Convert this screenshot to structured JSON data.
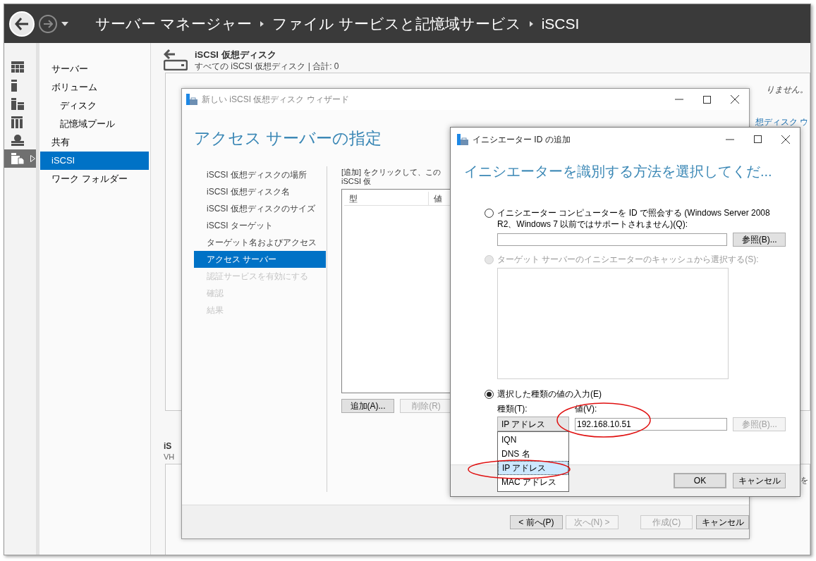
{
  "top_bar": {
    "back": {
      "disabled": false
    },
    "forward": {
      "disabled": true
    },
    "breadcrumb": [
      "サーバー マネージャー",
      "ファイル サービスと記憶域サービス",
      "iSCSI"
    ]
  },
  "rail": [
    {
      "kind": "dashboard",
      "selected": false
    },
    {
      "kind": "server",
      "selected": false
    },
    {
      "kind": "servers",
      "selected": false
    },
    {
      "kind": "group",
      "selected": false
    },
    {
      "kind": "network",
      "selected": false
    },
    {
      "kind": "storage",
      "selected": true
    }
  ],
  "nav": [
    {
      "label": "サーバー",
      "selected": false
    },
    {
      "label": "ボリューム",
      "selected": false,
      "children": [
        {
          "label": "ディスク",
          "selected": false
        },
        {
          "label": "記憶域プール",
          "selected": false
        }
      ]
    },
    {
      "label": "共有",
      "selected": false
    },
    {
      "label": "iSCSI",
      "selected": true
    },
    {
      "label": "ワーク フォルダー",
      "selected": false
    }
  ],
  "content": {
    "title": "iSCSI 仮想ディスク",
    "subtitle": "すべての iSCSI 仮想ディスク | 合計: 0",
    "panel_text_1": "りません。",
    "panel_link": "想ディスク ウ",
    "section_title": "iS",
    "section_subtitle": "VH",
    "section_text": "を"
  },
  "wizard": {
    "title": "新しい iSCSI 仮想ディスク ウィザード",
    "heading": "アクセス サーバーの指定",
    "steps": [
      {
        "label": "iSCSI 仮想ディスクの場所",
        "selected": false,
        "disabled": false
      },
      {
        "label": "iSCSI 仮想ディスク名",
        "selected": false,
        "disabled": false
      },
      {
        "label": "iSCSI 仮想ディスクのサイズ",
        "selected": false,
        "disabled": false
      },
      {
        "label": "iSCSI ターゲット",
        "selected": false,
        "disabled": false
      },
      {
        "label": "ターゲット名およびアクセス",
        "selected": false,
        "disabled": false
      },
      {
        "label": "アクセス サーバー",
        "selected": true,
        "disabled": false
      },
      {
        "label": "認証サービスを有効にする",
        "selected": false,
        "disabled": true
      },
      {
        "label": "確認",
        "selected": false,
        "disabled": true
      },
      {
        "label": "結果",
        "selected": false,
        "disabled": true
      }
    ],
    "instruction": "[追加] をクリックして、この iSCSI 仮",
    "table": {
      "columns": [
        "型",
        "値"
      ]
    },
    "buttons": [
      {
        "label": "追加(A)...",
        "disabled": false
      },
      {
        "label": "削除(R)",
        "disabled": true
      }
    ],
    "footer_buttons": [
      {
        "label": "< 前へ(P)",
        "disabled": false
      },
      {
        "label": "次へ(N) >",
        "disabled": true
      },
      {
        "label": "作成(C)",
        "disabled": true
      },
      {
        "label": "キャンセル",
        "disabled": false
      }
    ]
  },
  "dialog": {
    "title": "イニシエーター ID の追加",
    "heading": "イニシエーターを識別する方法を選択してくだ...",
    "options": [
      {
        "label": "イニシエーター コンピューターを ID で照会する (Windows Server 2008 R2、Windows 7 以前ではサポートされません)(Q):",
        "selected": false,
        "disabled": false
      },
      {
        "label": "ターゲット サーバーのイニシエーターのキャッシュから選択する(S):",
        "selected": false,
        "disabled": true
      },
      {
        "label": "選択した種類の値の入力(E)",
        "selected": true,
        "disabled": false
      }
    ],
    "query_browse": {
      "label": "参照(B)...",
      "disabled": false
    },
    "type_label": "種類(T):",
    "value_label": "値(V):",
    "type_combo": {
      "value": "IP アドレス",
      "expanded": true,
      "options": [
        {
          "label": "IQN",
          "selected": false
        },
        {
          "label": "DNS 名",
          "selected": false
        },
        {
          "label": "IP アドレス",
          "selected": true
        },
        {
          "label": "MAC アドレス",
          "selected": false
        }
      ]
    },
    "value_field": {
      "value": "192.168.10.51"
    },
    "value_browse": {
      "label": "参照(B)...",
      "disabled": true
    },
    "buttons": [
      {
        "label": "OK",
        "default": true
      },
      {
        "label": "キャンセル",
        "default": false
      }
    ]
  }
}
